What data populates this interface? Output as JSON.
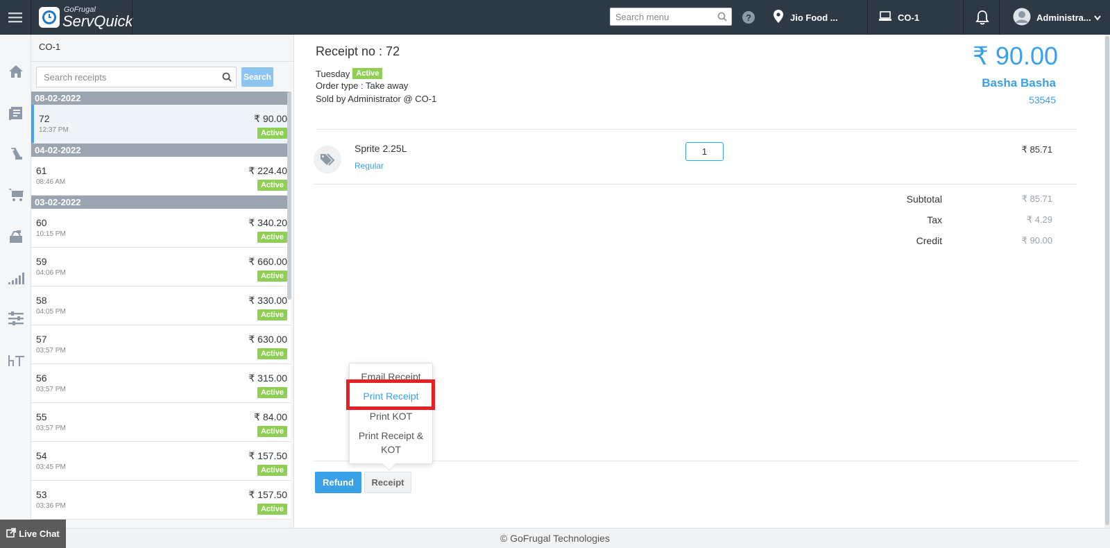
{
  "header": {
    "logo_small": "GoFrugal",
    "logo_big": "ServQuick",
    "search_placeholder": "Search menu",
    "location": "Jio Food ...",
    "counter": "CO-1",
    "user": "Administra...",
    "icons": [
      "menu-icon",
      "search-icon",
      "help-icon",
      "location-pin-icon",
      "computer-icon",
      "bell-icon",
      "user-avatar-icon",
      "caret-down-icon"
    ]
  },
  "sidebar": {
    "icons": [
      "home-icon",
      "receipts-icon",
      "bag-icon",
      "cart-icon",
      "cash-register-icon",
      "reports-icon",
      "settings-sliders-icon",
      "table-icon"
    ]
  },
  "list_panel": {
    "title": "CO-1",
    "search_placeholder": "Search receipts",
    "search_button": "Search",
    "groups": [
      {
        "date": "08-02-2022",
        "rows": [
          {
            "number": "72",
            "time": "12:37 PM",
            "amount": "₹ 90.00",
            "status": "Active",
            "selected": true
          }
        ]
      },
      {
        "date": "04-02-2022",
        "rows": [
          {
            "number": "61",
            "time": "08:46 AM",
            "amount": "₹ 224.40",
            "status": "Active"
          }
        ]
      },
      {
        "date": "03-02-2022",
        "rows": [
          {
            "number": "60",
            "time": "10:15 PM",
            "amount": "₹ 340.20",
            "status": "Active"
          },
          {
            "number": "59",
            "time": "04:06 PM",
            "amount": "₹ 660.00",
            "status": "Active"
          },
          {
            "number": "58",
            "time": "04:05 PM",
            "amount": "₹ 330.00",
            "status": "Active"
          },
          {
            "number": "57",
            "time": "03:57 PM",
            "amount": "₹ 630.00",
            "status": "Active"
          },
          {
            "number": "56",
            "time": "03:57 PM",
            "amount": "₹ 315.00",
            "status": "Active"
          },
          {
            "number": "55",
            "time": "03:57 PM",
            "amount": "₹ 84.00",
            "status": "Active"
          },
          {
            "number": "54",
            "time": "03:45 PM",
            "amount": "₹ 157.50",
            "status": "Active"
          },
          {
            "number": "53",
            "time": "03:36 PM",
            "amount": "₹ 157.50",
            "status": "Active"
          }
        ]
      }
    ]
  },
  "receipt": {
    "title": "Receipt no : 72",
    "day": "Tuesday",
    "status": "Active",
    "order_type": "Order type : Take away",
    "sold_by": "Sold by Administrator @ CO-1",
    "total": "₹ 90.00",
    "customer_name": "Basha Basha",
    "customer_phone": "53545",
    "item": {
      "name": "Sprite 2.25L",
      "variant": "Regular",
      "quantity": "1",
      "price": "₹ 85.71"
    },
    "summary": [
      {
        "label": "Subtotal",
        "value": "₹ 85.71"
      },
      {
        "label": "Tax",
        "value": "₹ 4.29"
      },
      {
        "label": "Credit",
        "value": "₹ 90.00"
      }
    ],
    "refund_button": "Refund",
    "receipt_button": "Receipt",
    "dropdown": {
      "email": "Email Receipt",
      "print": "Print Receipt",
      "kot": "Print KOT",
      "both": "Print Receipt & KOT"
    }
  },
  "footer": {
    "copyright": "© GoFrugal Technologies",
    "live_chat": "Live Chat"
  },
  "colors": {
    "topbar": "#2d3a46",
    "accent": "#3aa0e8",
    "active_badge": "#8fcf55",
    "date_header": "#9aa5b1",
    "highlight": "#e52125"
  }
}
